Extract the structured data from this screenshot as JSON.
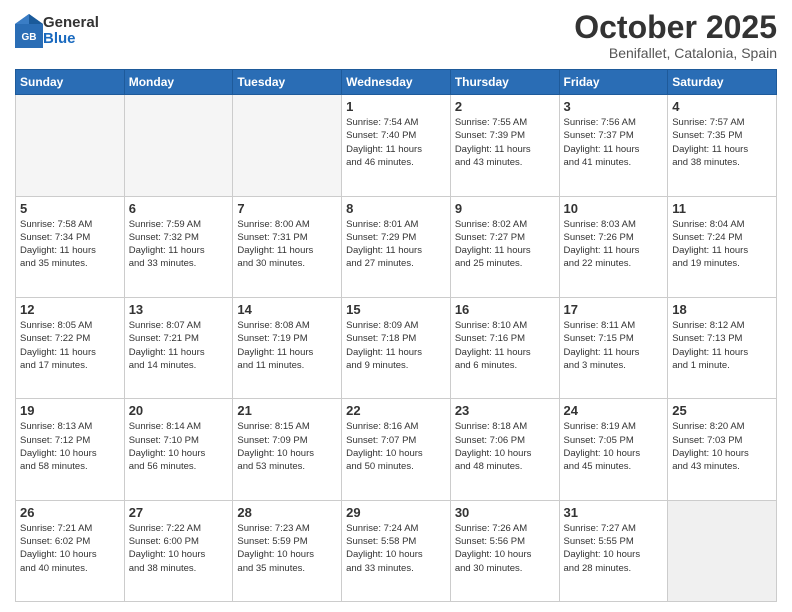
{
  "header": {
    "logo": {
      "general": "General",
      "blue": "Blue"
    },
    "title": "October 2025",
    "location": "Benifallet, Catalonia, Spain"
  },
  "weekdays": [
    "Sunday",
    "Monday",
    "Tuesday",
    "Wednesday",
    "Thursday",
    "Friday",
    "Saturday"
  ],
  "weeks": [
    [
      {
        "day": null,
        "info": null
      },
      {
        "day": null,
        "info": null
      },
      {
        "day": null,
        "info": null
      },
      {
        "day": "1",
        "info": "Sunrise: 7:54 AM\nSunset: 7:40 PM\nDaylight: 11 hours\nand 46 minutes."
      },
      {
        "day": "2",
        "info": "Sunrise: 7:55 AM\nSunset: 7:39 PM\nDaylight: 11 hours\nand 43 minutes."
      },
      {
        "day": "3",
        "info": "Sunrise: 7:56 AM\nSunset: 7:37 PM\nDaylight: 11 hours\nand 41 minutes."
      },
      {
        "day": "4",
        "info": "Sunrise: 7:57 AM\nSunset: 7:35 PM\nDaylight: 11 hours\nand 38 minutes."
      }
    ],
    [
      {
        "day": "5",
        "info": "Sunrise: 7:58 AM\nSunset: 7:34 PM\nDaylight: 11 hours\nand 35 minutes."
      },
      {
        "day": "6",
        "info": "Sunrise: 7:59 AM\nSunset: 7:32 PM\nDaylight: 11 hours\nand 33 minutes."
      },
      {
        "day": "7",
        "info": "Sunrise: 8:00 AM\nSunset: 7:31 PM\nDaylight: 11 hours\nand 30 minutes."
      },
      {
        "day": "8",
        "info": "Sunrise: 8:01 AM\nSunset: 7:29 PM\nDaylight: 11 hours\nand 27 minutes."
      },
      {
        "day": "9",
        "info": "Sunrise: 8:02 AM\nSunset: 7:27 PM\nDaylight: 11 hours\nand 25 minutes."
      },
      {
        "day": "10",
        "info": "Sunrise: 8:03 AM\nSunset: 7:26 PM\nDaylight: 11 hours\nand 22 minutes."
      },
      {
        "day": "11",
        "info": "Sunrise: 8:04 AM\nSunset: 7:24 PM\nDaylight: 11 hours\nand 19 minutes."
      }
    ],
    [
      {
        "day": "12",
        "info": "Sunrise: 8:05 AM\nSunset: 7:22 PM\nDaylight: 11 hours\nand 17 minutes."
      },
      {
        "day": "13",
        "info": "Sunrise: 8:07 AM\nSunset: 7:21 PM\nDaylight: 11 hours\nand 14 minutes."
      },
      {
        "day": "14",
        "info": "Sunrise: 8:08 AM\nSunset: 7:19 PM\nDaylight: 11 hours\nand 11 minutes."
      },
      {
        "day": "15",
        "info": "Sunrise: 8:09 AM\nSunset: 7:18 PM\nDaylight: 11 hours\nand 9 minutes."
      },
      {
        "day": "16",
        "info": "Sunrise: 8:10 AM\nSunset: 7:16 PM\nDaylight: 11 hours\nand 6 minutes."
      },
      {
        "day": "17",
        "info": "Sunrise: 8:11 AM\nSunset: 7:15 PM\nDaylight: 11 hours\nand 3 minutes."
      },
      {
        "day": "18",
        "info": "Sunrise: 8:12 AM\nSunset: 7:13 PM\nDaylight: 11 hours\nand 1 minute."
      }
    ],
    [
      {
        "day": "19",
        "info": "Sunrise: 8:13 AM\nSunset: 7:12 PM\nDaylight: 10 hours\nand 58 minutes."
      },
      {
        "day": "20",
        "info": "Sunrise: 8:14 AM\nSunset: 7:10 PM\nDaylight: 10 hours\nand 56 minutes."
      },
      {
        "day": "21",
        "info": "Sunrise: 8:15 AM\nSunset: 7:09 PM\nDaylight: 10 hours\nand 53 minutes."
      },
      {
        "day": "22",
        "info": "Sunrise: 8:16 AM\nSunset: 7:07 PM\nDaylight: 10 hours\nand 50 minutes."
      },
      {
        "day": "23",
        "info": "Sunrise: 8:18 AM\nSunset: 7:06 PM\nDaylight: 10 hours\nand 48 minutes."
      },
      {
        "day": "24",
        "info": "Sunrise: 8:19 AM\nSunset: 7:05 PM\nDaylight: 10 hours\nand 45 minutes."
      },
      {
        "day": "25",
        "info": "Sunrise: 8:20 AM\nSunset: 7:03 PM\nDaylight: 10 hours\nand 43 minutes."
      }
    ],
    [
      {
        "day": "26",
        "info": "Sunrise: 7:21 AM\nSunset: 6:02 PM\nDaylight: 10 hours\nand 40 minutes."
      },
      {
        "day": "27",
        "info": "Sunrise: 7:22 AM\nSunset: 6:00 PM\nDaylight: 10 hours\nand 38 minutes."
      },
      {
        "day": "28",
        "info": "Sunrise: 7:23 AM\nSunset: 5:59 PM\nDaylight: 10 hours\nand 35 minutes."
      },
      {
        "day": "29",
        "info": "Sunrise: 7:24 AM\nSunset: 5:58 PM\nDaylight: 10 hours\nand 33 minutes."
      },
      {
        "day": "30",
        "info": "Sunrise: 7:26 AM\nSunset: 5:56 PM\nDaylight: 10 hours\nand 30 minutes."
      },
      {
        "day": "31",
        "info": "Sunrise: 7:27 AM\nSunset: 5:55 PM\nDaylight: 10 hours\nand 28 minutes."
      },
      {
        "day": null,
        "info": null
      }
    ]
  ]
}
